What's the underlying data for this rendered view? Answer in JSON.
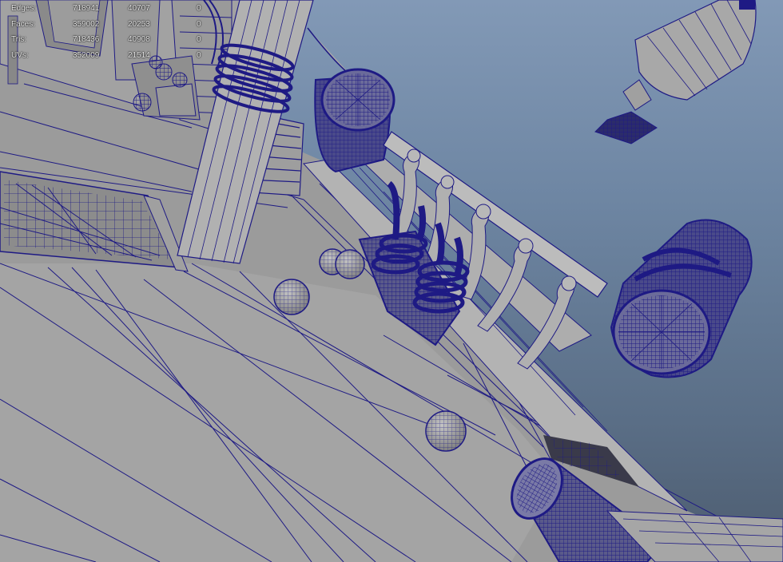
{
  "stats": {
    "rows": [
      {
        "label": "Edges:",
        "total": "718941",
        "selected": "40707",
        "components": "0"
      },
      {
        "label": "Faces:",
        "total": "359002",
        "selected": "20253",
        "components": "0"
      },
      {
        "label": "Tris:",
        "total": "718436",
        "selected": "40908",
        "components": "0"
      },
      {
        "label": "UVs:",
        "total": "352009",
        "selected": "21514",
        "components": "0"
      }
    ]
  },
  "colors": {
    "wireframe": "#1e1a84",
    "mesh_fill": "#a9a9a9",
    "background_top": "#8299b6",
    "background_bottom": "#4d5c6f",
    "hud_text": "#e9e9e9"
  }
}
